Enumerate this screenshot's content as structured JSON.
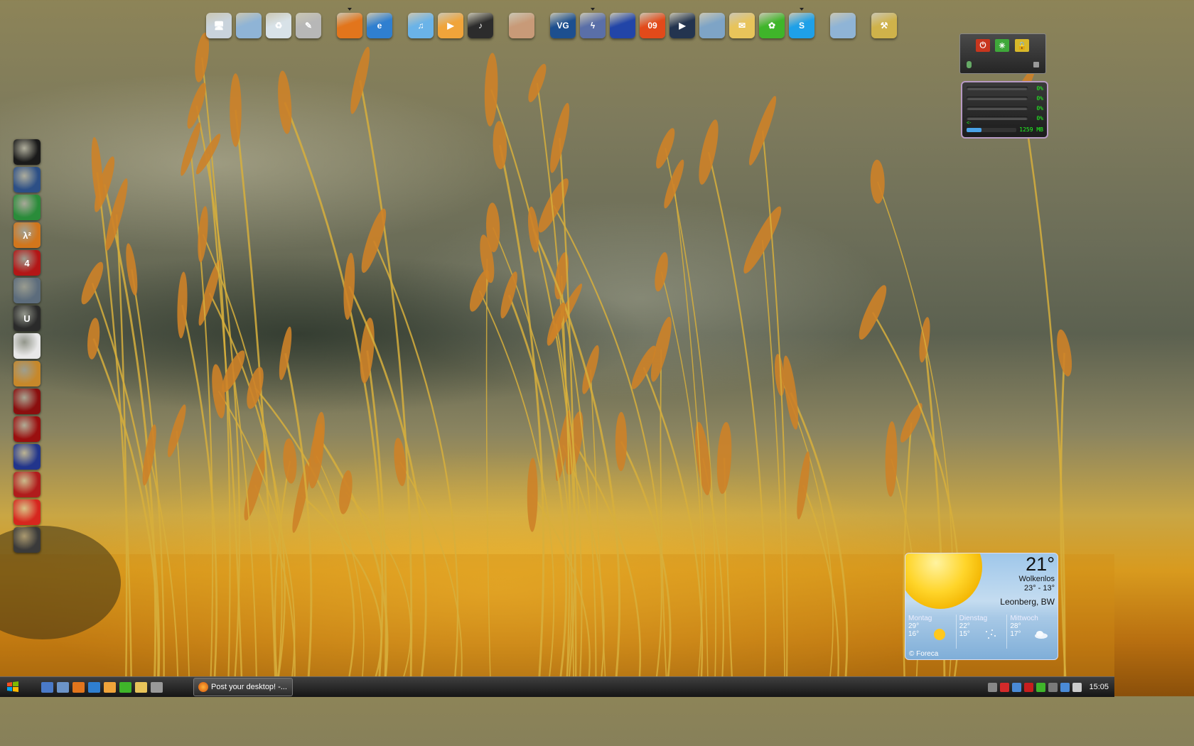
{
  "dock": {
    "icons": [
      {
        "name": "computer-icon",
        "color": "#c9d3dc",
        "glyph": "🖥",
        "running": false
      },
      {
        "name": "folder-icon",
        "color": "#8fb4d6",
        "glyph": "",
        "running": false
      },
      {
        "name": "recycle-bin-icon",
        "color": "#d8e2e8",
        "glyph": "♻",
        "running": false
      },
      {
        "name": "tools-icon",
        "color": "#b7b7b7",
        "glyph": "✎",
        "running": false
      },
      {
        "gap": true
      },
      {
        "name": "firefox-icon",
        "color": "#e2751c",
        "glyph": "",
        "running": true
      },
      {
        "name": "internet-explorer-icon",
        "color": "#2f7fd0",
        "glyph": "e",
        "running": false
      },
      {
        "gap": true
      },
      {
        "name": "itunes-icon",
        "color": "#6ab3e8",
        "glyph": "♫",
        "running": false
      },
      {
        "name": "media-player-icon",
        "color": "#f0a43a",
        "glyph": "▶",
        "running": false
      },
      {
        "name": "music-icon",
        "color": "#2c2c2c",
        "glyph": "♪",
        "running": false
      },
      {
        "gap": true
      },
      {
        "name": "photos-icon",
        "color": "#c89a78",
        "glyph": "",
        "running": false
      },
      {
        "gap": true
      },
      {
        "name": "vg-icon",
        "color": "#1d4f8f",
        "glyph": "VG",
        "running": false
      },
      {
        "name": "lightning-icon",
        "color": "#5a6fa8",
        "glyph": "ϟ",
        "running": true
      },
      {
        "name": "save-disk-icon",
        "color": "#2245a8",
        "glyph": "",
        "running": false
      },
      {
        "name": "nero-09-icon",
        "color": "#e24a1a",
        "glyph": "09",
        "running": false
      },
      {
        "name": "play-icon",
        "color": "#23344f",
        "glyph": "▶",
        "running": false
      },
      {
        "name": "headset-icon",
        "color": "#7ea4c6",
        "glyph": "",
        "running": false
      },
      {
        "name": "mail-icon",
        "color": "#e8c45a",
        "glyph": "✉",
        "running": false
      },
      {
        "name": "icq-icon",
        "color": "#3fb52a",
        "glyph": "✿",
        "running": false
      },
      {
        "name": "skype-icon",
        "color": "#1ea0e8",
        "glyph": "S",
        "running": true
      },
      {
        "gap": true
      },
      {
        "name": "documents-folder-icon",
        "color": "#8fb4d6",
        "glyph": "",
        "running": false
      },
      {
        "gap": true
      },
      {
        "name": "hammer-tools-icon",
        "color": "#cfb24a",
        "glyph": "⚒",
        "running": false
      }
    ]
  },
  "sidebar": {
    "icons": [
      {
        "name": "steam-icon",
        "color": "#1a1a1a",
        "text": ""
      },
      {
        "name": "counter-strike-icon",
        "color": "#2c4f86",
        "text": ""
      },
      {
        "name": "game-icon-3",
        "color": "#2a8c3a",
        "text": ""
      },
      {
        "name": "half-life-2-icon",
        "color": "#d2761c",
        "text": "λ²"
      },
      {
        "name": "left-4-dead-icon",
        "color": "#b31616",
        "text": "4"
      },
      {
        "name": "crysis-icon",
        "color": "#5c6c7c",
        "text": ""
      },
      {
        "name": "unreal-tournament-icon",
        "color": "#2a2a2a",
        "text": "U"
      },
      {
        "name": "game-icon-8",
        "color": "#e8e8e8",
        "text": ""
      },
      {
        "name": "game-icon-9",
        "color": "#c7882a",
        "text": ""
      },
      {
        "name": "fear-2-icon",
        "color": "#8a0e0e",
        "text": ""
      },
      {
        "name": "game-icon-11",
        "color": "#9a0f0f",
        "text": ""
      },
      {
        "name": "game-icon-12",
        "color": "#22358c",
        "text": ""
      },
      {
        "name": "game-icon-13",
        "color": "#b01c1c",
        "text": ""
      },
      {
        "name": "game-icon-14",
        "color": "#d6261e",
        "text": ""
      },
      {
        "name": "game-icon-15",
        "color": "#3a3a3a",
        "text": ""
      }
    ]
  },
  "cpu_meter": {
    "cores": [
      "0%",
      "0%",
      "0%",
      "0%"
    ],
    "arrow": "<-",
    "memory": "1259 MB",
    "memory_fraction": 0.3
  },
  "weather": {
    "temperature": "21°",
    "condition": "Wolkenlos",
    "range": "23° - 13°",
    "location": "Leonberg, BW",
    "source": "© Foreca",
    "forecast": [
      {
        "day": "Montag",
        "high": "29°",
        "low": "16°",
        "icon": "sun-icon"
      },
      {
        "day": "Dienstag",
        "high": "22°",
        "low": "15°",
        "icon": "stars-icon"
      },
      {
        "day": "Mittwoch",
        "high": "28°",
        "low": "17°",
        "icon": "cloud-icon"
      }
    ]
  },
  "taskbar": {
    "window_title": "Post your desktop! -...",
    "clock": "15:05",
    "quick_launch": [
      {
        "name": "show-desktop-icon",
        "color": "#4a7ac8"
      },
      {
        "name": "switch-windows-icon",
        "color": "#6c94c8"
      },
      {
        "name": "firefox-quick-icon",
        "color": "#e2751c"
      },
      {
        "name": "ie-quick-icon",
        "color": "#2f7fd0"
      },
      {
        "name": "media-quick-icon",
        "color": "#f0a43a"
      },
      {
        "name": "icq-quick-icon",
        "color": "#3fb52a"
      },
      {
        "name": "mail-quick-icon",
        "color": "#e8c45a"
      },
      {
        "name": "music-quick-icon",
        "color": "#999999"
      }
    ],
    "tray": [
      {
        "name": "tray-expand-icon",
        "color": "#888888"
      },
      {
        "name": "antivirus-tray-icon",
        "color": "#d42a2a"
      },
      {
        "name": "network-tray-icon",
        "color": "#4a8ad6"
      },
      {
        "name": "adobe-tray-icon",
        "color": "#c81e1e"
      },
      {
        "name": "security-tray-icon",
        "color": "#3fb52a"
      },
      {
        "name": "app-tray-icon",
        "color": "#7a7a7a"
      },
      {
        "name": "connection-tray-icon",
        "color": "#4a8ad6"
      },
      {
        "name": "volume-tray-icon",
        "color": "#cccccc"
      }
    ]
  }
}
